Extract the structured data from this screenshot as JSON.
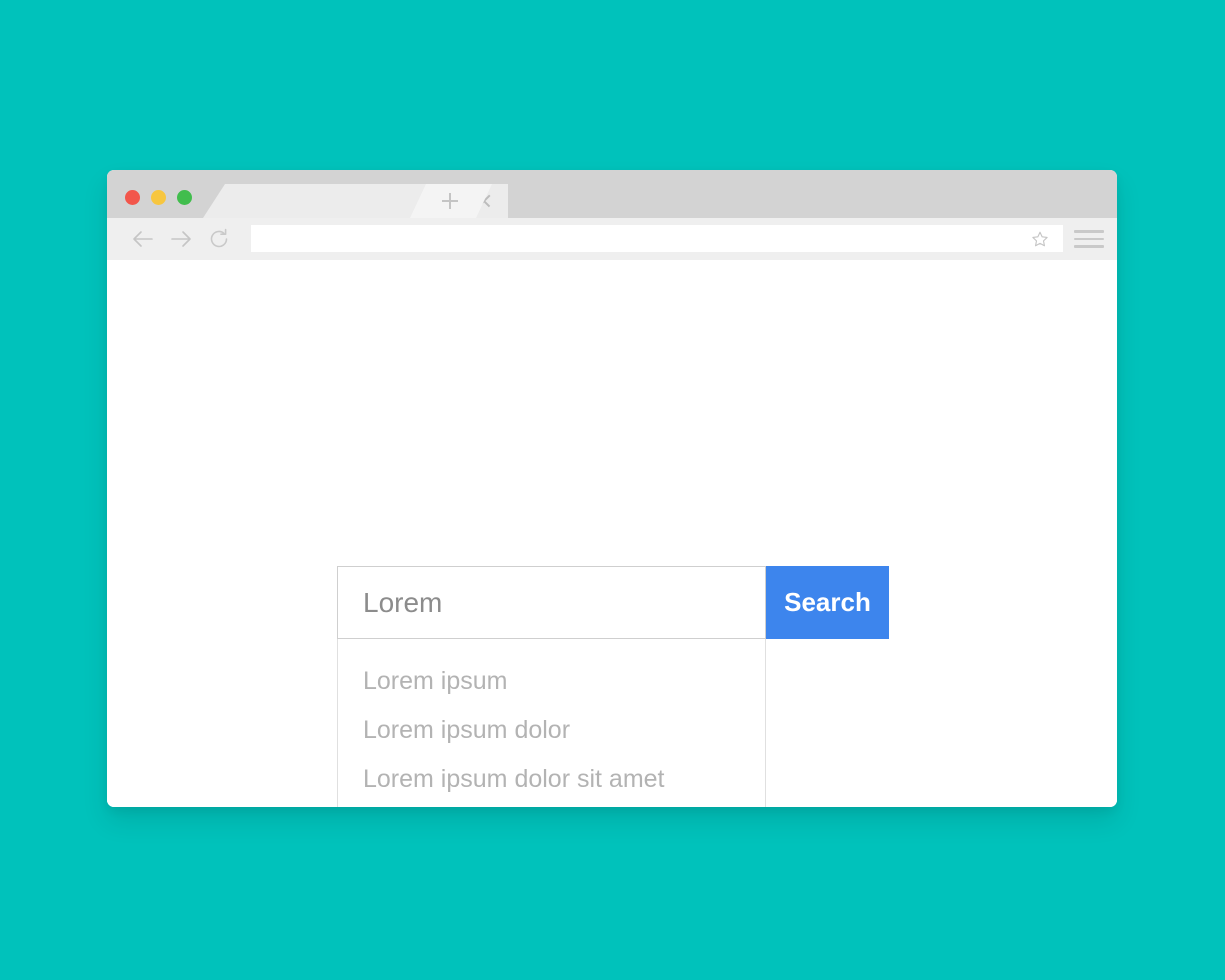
{
  "theme": {
    "background_color": "#00c2bb",
    "accent_color": "#3d85ed",
    "tabbar_color": "#d3d3d3",
    "toolbar_color": "#efefef",
    "window_color": "#ffffff"
  },
  "browser": {
    "window_controls": [
      {
        "name": "close",
        "color": "#f2564b"
      },
      {
        "name": "minimize",
        "color": "#f7c63f"
      },
      {
        "name": "maximize",
        "color": "#41bd4d"
      }
    ],
    "tabs": [
      {
        "title": "",
        "active": true,
        "close_icon": "close-icon"
      }
    ],
    "new_tab_icon": "plus-icon",
    "toolbar": {
      "back_icon": "arrow-left-icon",
      "forward_icon": "arrow-right-icon",
      "reload_icon": "reload-icon",
      "bookmark_icon": "star-icon",
      "menu_icon": "hamburger-menu-icon",
      "url_value": "",
      "url_placeholder": ""
    }
  },
  "search": {
    "input_value": "Lorem",
    "input_placeholder": "Lorem",
    "button_label": "Search",
    "suggestions": [
      "Lorem ipsum",
      "Lorem ipsum dolor",
      "Lorem ipsum dolor sit amet"
    ]
  }
}
